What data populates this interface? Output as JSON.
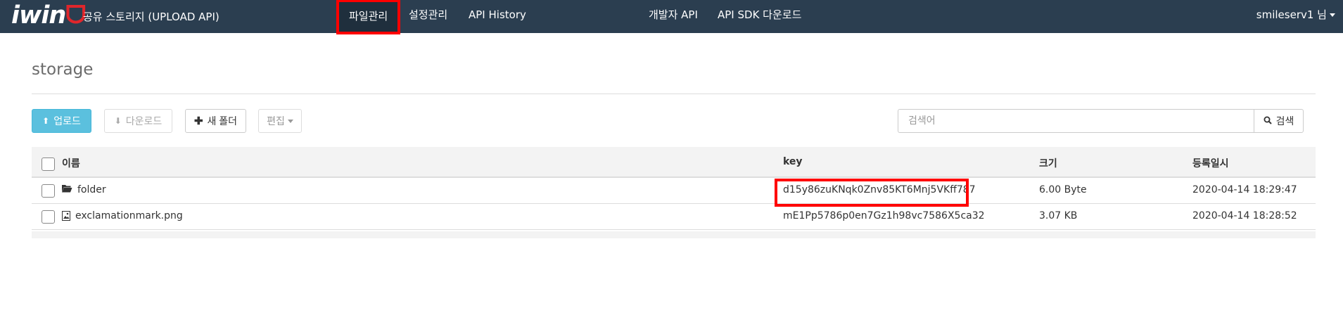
{
  "brand": {
    "logo_text": "iwin",
    "logo_mark": "ᗜ",
    "subtitle": "공유 스토리지 (UPLOAD API)"
  },
  "nav": {
    "items": [
      {
        "label": "파일관리",
        "active": true
      },
      {
        "label": "설정관리"
      },
      {
        "label": "API History"
      },
      {
        "label": "개발자 API"
      },
      {
        "label": "API SDK 다운로드"
      }
    ],
    "user": "smileserv1 님"
  },
  "page": {
    "title": "storage"
  },
  "toolbar": {
    "upload": "업로드",
    "download": "다운로드",
    "new_folder": "새 폴더",
    "edit": "편집",
    "search_placeholder": "검색어",
    "search_button": "검색"
  },
  "icons": {
    "upload": "upload-icon",
    "download": "download-icon",
    "plus": "plus-icon",
    "search": "search-icon",
    "folder": "folder-open-icon",
    "image_file": "image-file-icon"
  },
  "table": {
    "columns": [
      "이름",
      "key",
      "크기",
      "등록일시"
    ],
    "rows": [
      {
        "name": "folder",
        "type": "folder",
        "key": "d15y86zuKNqk0Znv85KT6Mnj5VKff787",
        "size": "6.00 Byte",
        "date": "2020-04-14 18:29:47"
      },
      {
        "name": "exclamationmark.png",
        "type": "image",
        "key": "mE1Pp5786p0en7Gz1h98vc7586X5ca32",
        "size": "3.07 KB",
        "date": "2020-04-14 18:28:52"
      }
    ]
  },
  "colors": {
    "navbar": "#2b3e50",
    "highlight": "#ff0000",
    "upload_button": "#5bc0de",
    "logo_mark": "#e0262b"
  }
}
